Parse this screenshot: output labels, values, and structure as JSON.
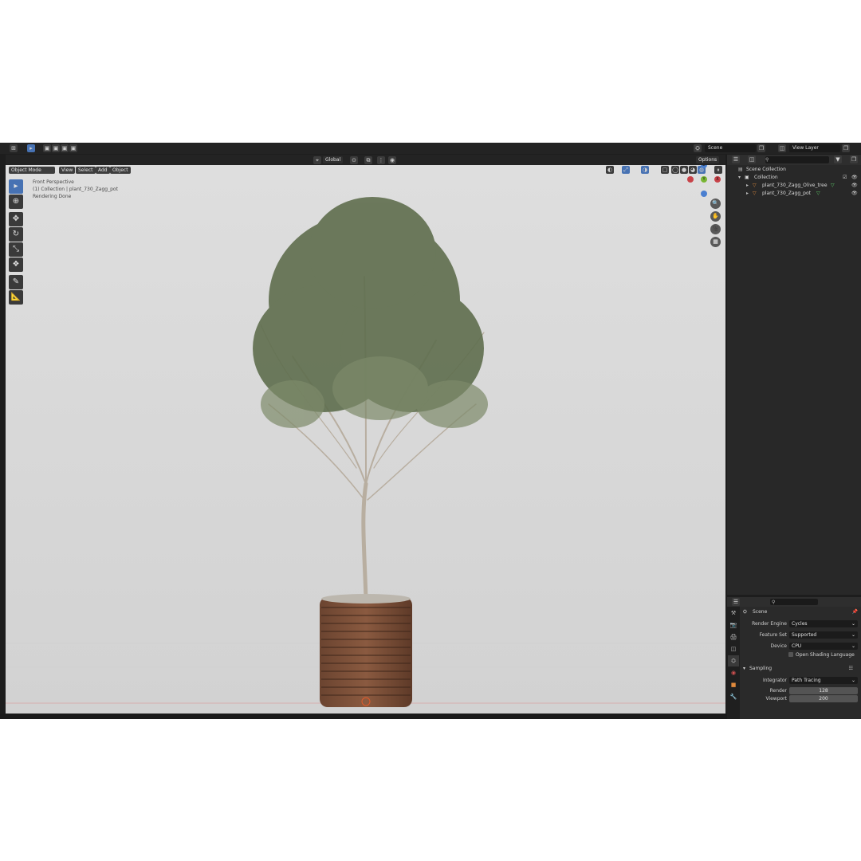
{
  "topbar": {
    "scene_label": "Scene",
    "view_layer_label": "View Layer"
  },
  "viewport_header": {
    "mode": "Object Mode",
    "menus": [
      "View",
      "Select",
      "Add",
      "Object"
    ],
    "transform_orientation": "Global",
    "options_label": "Options"
  },
  "viewport": {
    "info_lines": [
      "Front Perspective",
      "(1) Collection | plant_730_Zagg_pot",
      "Rendering Done"
    ],
    "axes": {
      "x": "X",
      "y": "Y",
      "z": "Z"
    }
  },
  "outliner": {
    "search_placeholder": "",
    "scene_collection": "Scene Collection",
    "collection": "Collection",
    "objects": [
      "plant_730_Zagg_Olive_tree",
      "plant_730_Zagg_pot"
    ]
  },
  "properties": {
    "context": "Scene",
    "render_engine_label": "Render Engine",
    "render_engine": "Cycles",
    "feature_set_label": "Feature Set",
    "feature_set": "Supported",
    "device_label": "Device",
    "device": "CPU",
    "osl_label": "Open Shading Language",
    "sampling_label": "Sampling",
    "integrator_label": "Integrator",
    "integrator": "Path Tracing",
    "render_label": "Render",
    "render_samples": "128",
    "viewport_label": "Viewport",
    "viewport_samples": "200"
  },
  "colors": {
    "accent": "#4772b3",
    "viewport_bg": "#dcdcdc",
    "panel_bg": "#282828"
  }
}
